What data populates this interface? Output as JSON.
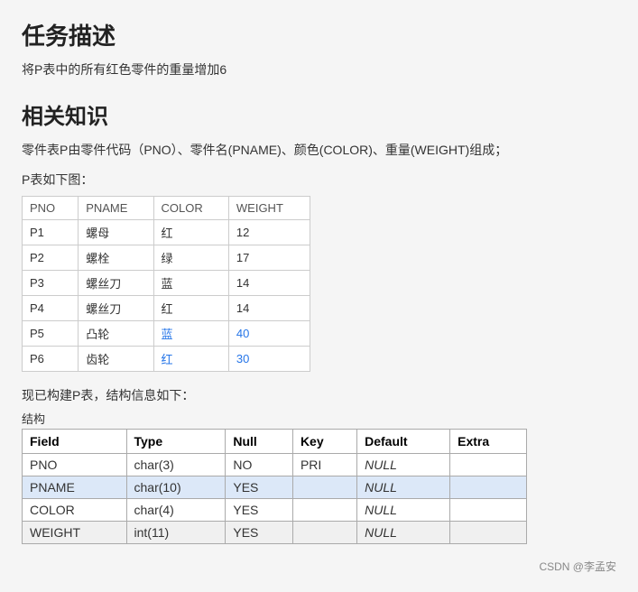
{
  "page": {
    "title": "任务描述",
    "task_description": "将P表中的所有红色零件的重量增加6",
    "knowledge_title": "相关知识",
    "knowledge_desc": "零件表P由零件代码（PNO）、零件名(PNAME)、颜色(COLOR)、重量(WEIGHT)组成；",
    "table_intro": "P表如下图：",
    "data_table": {
      "headers": [
        "PNO",
        "PNAME",
        "COLOR",
        "WEIGHT"
      ],
      "rows": [
        {
          "pno": "P1",
          "pname": "螺母",
          "color": "红",
          "weight": "12",
          "highlight": false
        },
        {
          "pno": "P2",
          "pname": "螺栓",
          "color": "绿",
          "weight": "17",
          "highlight": false
        },
        {
          "pno": "P3",
          "pname": "螺丝刀",
          "color": "蓝",
          "weight": "14",
          "highlight": false
        },
        {
          "pno": "P4",
          "pname": "螺丝刀",
          "color": "红",
          "weight": "14",
          "highlight": false
        },
        {
          "pno": "P5",
          "pname": "凸轮",
          "color": "蓝",
          "weight": "40",
          "highlight": true
        },
        {
          "pno": "P6",
          "pname": "齿轮",
          "color": "红",
          "weight": "30",
          "highlight": true
        }
      ]
    },
    "struct_intro": "现已构建P表，结构信息如下：",
    "struct_hint": "结构",
    "struct_table": {
      "headers": [
        "Field",
        "Type",
        "Null",
        "Key",
        "Default",
        "Extra"
      ],
      "rows": [
        {
          "field": "PNO",
          "type": "char(3)",
          "null": "NO",
          "key": "PRI",
          "default": "NULL",
          "extra": "",
          "row_class": "plain"
        },
        {
          "field": "PNAME",
          "type": "char(10)",
          "null": "YES",
          "key": "",
          "default": "NULL",
          "extra": "",
          "row_class": "highlighted"
        },
        {
          "field": "COLOR",
          "type": "char(4)",
          "null": "YES",
          "key": "",
          "default": "NULL",
          "extra": "",
          "row_class": "plain"
        },
        {
          "field": "WEIGHT",
          "type": "int(11)",
          "null": "YES",
          "key": "",
          "default": "NULL",
          "extra": "",
          "row_class": "gray"
        }
      ]
    },
    "footer": "CSDN @李孟安"
  }
}
